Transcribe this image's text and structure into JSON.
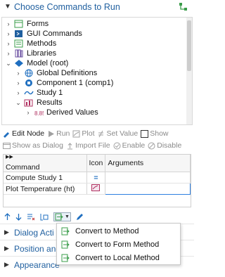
{
  "header": {
    "title": "Choose Commands to Run"
  },
  "tree": [
    {
      "label": "Forms",
      "expand": ">",
      "indent": 0
    },
    {
      "label": "GUI Commands",
      "expand": ">",
      "indent": 0
    },
    {
      "label": "Methods",
      "expand": ">",
      "indent": 0
    },
    {
      "label": "Libraries",
      "expand": ">",
      "indent": 0
    },
    {
      "label": "Model (root)",
      "expand": "v",
      "indent": 0
    },
    {
      "label": "Global Definitions",
      "expand": ">",
      "indent": 1
    },
    {
      "label": "Component 1 (comp1)",
      "expand": ">",
      "indent": 1
    },
    {
      "label": "Study 1",
      "expand": ">",
      "indent": 1
    },
    {
      "label": "Results",
      "expand": "v",
      "indent": 1
    },
    {
      "label": "Derived Values",
      "expand": ">",
      "indent": 2
    }
  ],
  "toolbar1": {
    "edit_node": "Edit Node",
    "run": "Run",
    "plot": "Plot",
    "set_value": "Set Value",
    "show": "Show"
  },
  "toolbar2": {
    "show_as_dialog": "Show as Dialog",
    "import_file": "Import File",
    "enable": "Enable",
    "disable": "Disable"
  },
  "grid": {
    "headers": [
      "Command",
      "Icon",
      "Arguments"
    ],
    "rows": [
      {
        "command": "Compute Study 1",
        "icon": "=",
        "arguments": ""
      },
      {
        "command": "Plot Temperature (ht)",
        "icon": "plot",
        "arguments": ""
      }
    ]
  },
  "sections": {
    "dialog_actions": "Dialog Acti",
    "position_and": "Position and",
    "appearance": "Appearance"
  },
  "menu": {
    "items": [
      "Convert to Method",
      "Convert to Form Method",
      "Convert to Local Method"
    ]
  },
  "colors": {
    "accent": "#1f5f9f",
    "selection": "#2d7fe0",
    "green": "#3a9c4a"
  }
}
